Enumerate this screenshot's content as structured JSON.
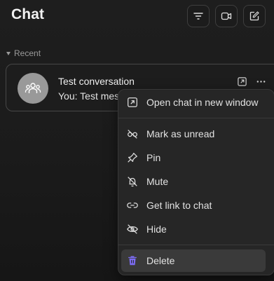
{
  "header": {
    "title": "Chat",
    "buttons": [
      {
        "name": "filter",
        "icon": "filter-icon"
      },
      {
        "name": "video",
        "icon": "video-camera-icon"
      },
      {
        "name": "new-chat",
        "icon": "compose-icon"
      }
    ]
  },
  "section": {
    "label": "Recent"
  },
  "conversation": {
    "name": "Test conversation",
    "last_message": "You: Test mes",
    "avatar_icon": "group-icon",
    "action_icons": [
      "open-external-icon",
      "more-icon"
    ]
  },
  "context_menu": {
    "items": [
      {
        "label": "Open chat in new window",
        "icon": "open-external-icon"
      },
      {
        "label": "Mark as unread",
        "icon": "eye-off-icon"
      },
      {
        "label": "Pin",
        "icon": "pin-icon"
      },
      {
        "label": "Mute",
        "icon": "bell-off-icon"
      },
      {
        "label": "Get link to chat",
        "icon": "link-icon"
      },
      {
        "label": "Hide",
        "icon": "eye-slash-icon"
      },
      {
        "label": "Delete",
        "icon": "trash-icon",
        "highlighted": true
      }
    ]
  },
  "colors": {
    "background": "#1b1b1b",
    "menu_background": "#262626",
    "highlight": "#3a3a3a",
    "delete_icon": "#7c6cf2"
  }
}
